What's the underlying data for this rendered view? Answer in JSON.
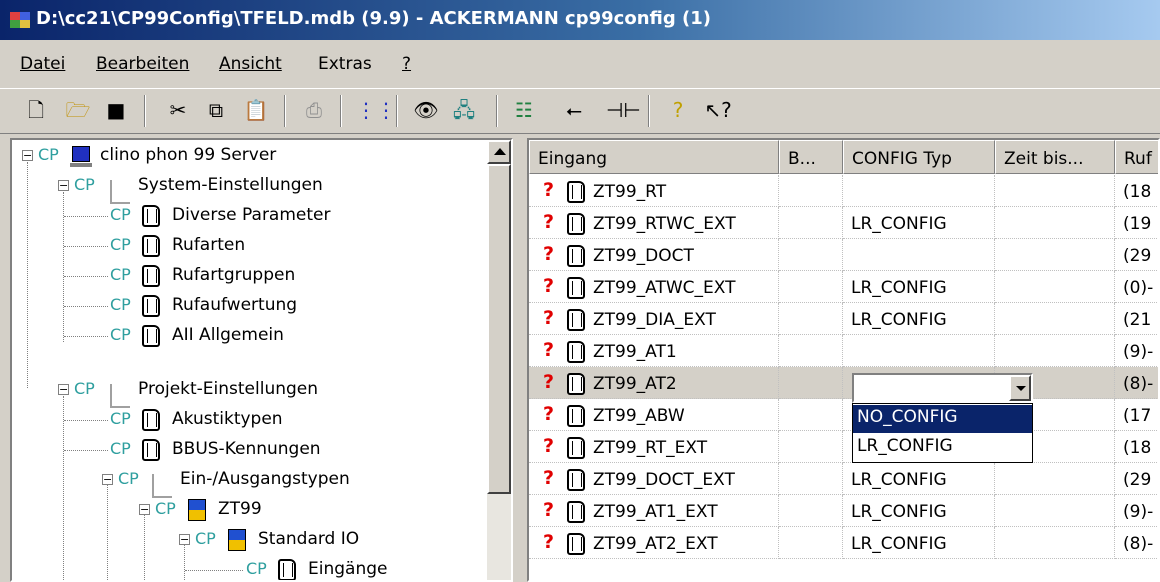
{
  "window": {
    "title": "D:\\cc21\\CP99Config\\TFELD.mdb (9.9) - ACKERMANN cp99config (1)"
  },
  "menu": [
    "Datei",
    "Bearbeiten",
    "Ansicht",
    "Extras",
    "?"
  ],
  "toolbar": {
    "icons": [
      "new-icon",
      "open-icon",
      "save-icon",
      "cut-icon",
      "copy-icon",
      "paste-icon",
      "print-icon",
      "grid-icon",
      "view-icon",
      "network-icon",
      "tree-icon",
      "usb-icon",
      "connector-icon",
      "help-icon",
      "context-help-icon"
    ]
  },
  "tree": {
    "prefix": "CP",
    "items": [
      {
        "label": "clino phon 99 Server"
      },
      {
        "label": "System-Einstellungen"
      },
      {
        "label": "Diverse Parameter"
      },
      {
        "label": "Rufarten"
      },
      {
        "label": "Rufartgruppen"
      },
      {
        "label": "Rufaufwertung"
      },
      {
        "label": "AII Allgemein"
      },
      {
        "label": "Projekt-Einstellungen"
      },
      {
        "label": "Akustiktypen"
      },
      {
        "label": "BBUS-Kennungen"
      },
      {
        "label": "Ein-/Ausgangstypen"
      },
      {
        "label": "ZT99"
      },
      {
        "label": "Standard IO"
      },
      {
        "label": "Eingänge"
      }
    ]
  },
  "list": {
    "columns": [
      "Eingang",
      "B...",
      "CONFIG Typ",
      "Zeit bis...",
      "Ruf"
    ],
    "status_glyph": "?",
    "rows": [
      {
        "eingang": "ZT99_RT",
        "b": "",
        "config": "",
        "zeit": "",
        "ruf": "(18"
      },
      {
        "eingang": "ZT99_RTWC_EXT",
        "b": "",
        "config": "LR_CONFIG",
        "zeit": "",
        "ruf": "(19"
      },
      {
        "eingang": "ZT99_DOCT",
        "b": "",
        "config": "",
        "zeit": "",
        "ruf": "(29"
      },
      {
        "eingang": "ZT99_ATWC_EXT",
        "b": "",
        "config": "LR_CONFIG",
        "zeit": "",
        "ruf": "(0)-"
      },
      {
        "eingang": "ZT99_DIA_EXT",
        "b": "",
        "config": "LR_CONFIG",
        "zeit": "",
        "ruf": "(21"
      },
      {
        "eingang": "ZT99_AT1",
        "b": "",
        "config": "",
        "zeit": "",
        "ruf": "(9)-"
      },
      {
        "eingang": "ZT99_AT2",
        "b": "",
        "config": "",
        "zeit": "",
        "ruf": "(8)-"
      },
      {
        "eingang": "ZT99_ABW",
        "b": "",
        "config": "",
        "zeit": "",
        "ruf": "(17"
      },
      {
        "eingang": "ZT99_RT_EXT",
        "b": "",
        "config": "",
        "zeit": "",
        "ruf": "(18"
      },
      {
        "eingang": "ZT99_DOCT_EXT",
        "b": "",
        "config": "LR_CONFIG",
        "zeit": "",
        "ruf": "(29"
      },
      {
        "eingang": "ZT99_AT1_EXT",
        "b": "",
        "config": "LR_CONFIG",
        "zeit": "",
        "ruf": "(9)-"
      },
      {
        "eingang": "ZT99_AT2_EXT",
        "b": "",
        "config": "LR_CONFIG",
        "zeit": "",
        "ruf": "(8)-"
      }
    ],
    "selected_row": "ZT99_AT2",
    "combo": {
      "value": "",
      "options": [
        "NO_CONFIG",
        "LR_CONFIG"
      ],
      "highlighted": "NO_CONFIG"
    }
  },
  "colors": {
    "title_start": "#0a246a",
    "title_end": "#a6caf0",
    "cp_text": "#2f9f9f",
    "status_red": "#e00000",
    "highlight": "#0a246a"
  }
}
